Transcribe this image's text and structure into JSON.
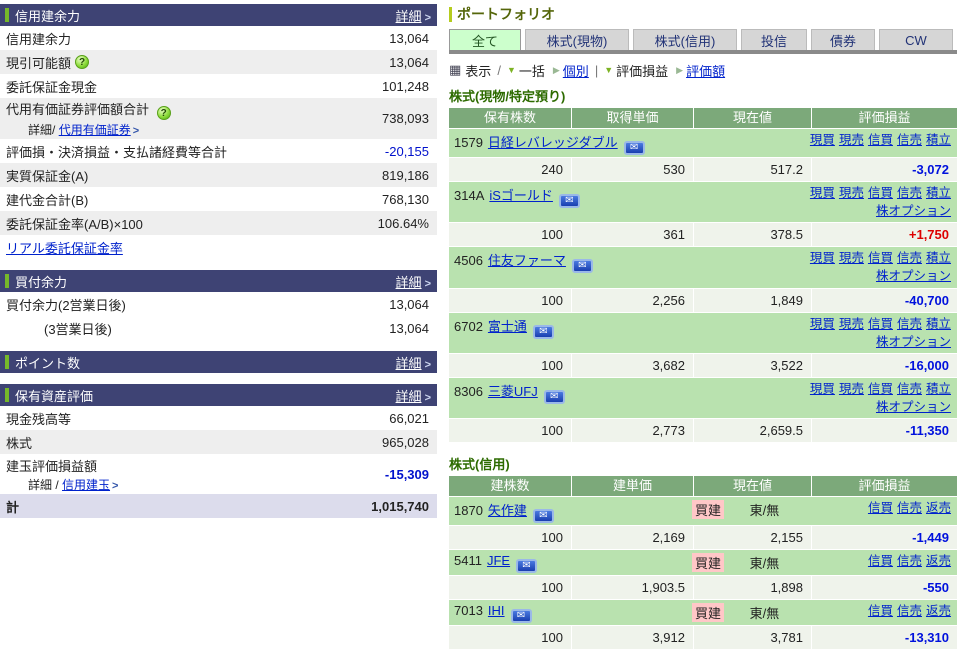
{
  "colors": {
    "header_navy": "#3E4374",
    "accent_green": "#76B82A",
    "portfolio_olive": "#55660A",
    "portfolio_bar": "#B5CC1E",
    "table_header_green": "#7CA97A",
    "name_row_green": "#B9E2AF",
    "data_row_light": "#EFF3EB",
    "link_blue": "#0022CC",
    "negative_blue": "#0011DD",
    "positive_red": "#DD0000",
    "active_tab_bg": "#CCFFCC",
    "inactive_tab_bg": "#D6D6D6",
    "badge_pink": "#FFC7C7",
    "total_row_lavender": "#DCDCEC"
  },
  "left_panel": {
    "sections": [
      {
        "title": "信用建余力",
        "detail": "詳細",
        "rows": [
          {
            "label": "信用建余力",
            "value": "13,064"
          },
          {
            "label": "現引可能額",
            "value": "13,064"
          },
          {
            "label": "委託保証金現金",
            "value": "101,248"
          },
          {
            "label": "代用有価証券評価額合計",
            "value": "738,093",
            "sub_prefix": "詳細/",
            "sub_link": "代用有価証券"
          },
          {
            "label": "評価損・決済損益・支払諸経費等合計",
            "value": "-20,155"
          },
          {
            "label": "実質保証金(A)",
            "value": "819,186"
          },
          {
            "label": "建代金合計(B)",
            "value": "768,130"
          },
          {
            "label": "委託保証金率(A/B)×100",
            "value": "106.64%"
          },
          {
            "link": "リアル委託保証金率"
          }
        ]
      },
      {
        "title": "買付余力",
        "detail": "詳細",
        "rows": [
          {
            "label": "買付余力(2営業日後)",
            "value": "13,064"
          },
          {
            "label": "(3営業日後)",
            "value": "13,064"
          }
        ]
      },
      {
        "title": "ポイント数",
        "detail": "詳細"
      },
      {
        "title": "保有資産評価",
        "detail": "詳細",
        "rows": [
          {
            "label": "現金残高等",
            "value": "66,021"
          },
          {
            "label": "株式",
            "value": "965,028"
          },
          {
            "label": "建玉評価損益額",
            "value": "-15,309",
            "sub_prefix": "詳細 /",
            "sub_link": "信用建玉"
          },
          {
            "label": "計",
            "value": "1,015,740"
          }
        ]
      }
    ]
  },
  "portfolio": {
    "title": "ポートフォリオ",
    "tabs": [
      {
        "label": "全て",
        "active": true
      },
      {
        "label": "株式(現物)",
        "active": false
      },
      {
        "label": "株式(信用)",
        "active": false
      },
      {
        "label": "投信",
        "active": false
      },
      {
        "label": "債券",
        "active": false
      },
      {
        "label": "CW",
        "active": false
      }
    ],
    "toolbar": {
      "view_label": "表示",
      "batch_label": "一括",
      "individual_label": "個別",
      "pl_label": "評価損益",
      "value_label": "評価額"
    },
    "cash_section": {
      "title": "株式(現物/特定預り)",
      "headers": [
        "保有株数",
        "取得単価",
        "現在値",
        "評価損益"
      ],
      "action_links": [
        "現買",
        "現売",
        "信買",
        "信売",
        "積立"
      ],
      "option_link": "株オプション",
      "stocks": [
        {
          "code": "1579",
          "name": "日経レバレッジダブル",
          "qty": "240",
          "price": "530",
          "current": "517.2",
          "pl": "-3,072"
        },
        {
          "code": "314A",
          "name": "iSゴールド",
          "qty": "100",
          "price": "361",
          "current": "378.5",
          "pl": "+1,750"
        },
        {
          "code": "4506",
          "name": "住友ファーマ",
          "qty": "100",
          "price": "2,256",
          "current": "1,849",
          "pl": "-40,700"
        },
        {
          "code": "6702",
          "name": "富士通",
          "qty": "100",
          "price": "3,682",
          "current": "3,522",
          "pl": "-16,000"
        },
        {
          "code": "8306",
          "name": "三菱UFJ",
          "qty": "100",
          "price": "2,773",
          "current": "2,659.5",
          "pl": "-11,350"
        }
      ]
    },
    "margin_section": {
      "title": "株式(信用)",
      "headers": [
        "建株数",
        "建単価",
        "現在値",
        "評価損益"
      ],
      "action_links": [
        "信買",
        "信売",
        "返売"
      ],
      "position_type": "買建",
      "market": "東/無",
      "stocks": [
        {
          "code": "1870",
          "name": "矢作建",
          "qty": "100",
          "price": "2,169",
          "current": "2,155",
          "pl": "-1,449"
        },
        {
          "code": "5411",
          "name": "JFE",
          "qty": "100",
          "price": "1,903.5",
          "current": "1,898",
          "pl": "-550"
        },
        {
          "code": "7013",
          "name": "IHI",
          "qty": "100",
          "price": "3,912",
          "current": "3,781",
          "pl": "-13,310"
        }
      ]
    }
  }
}
